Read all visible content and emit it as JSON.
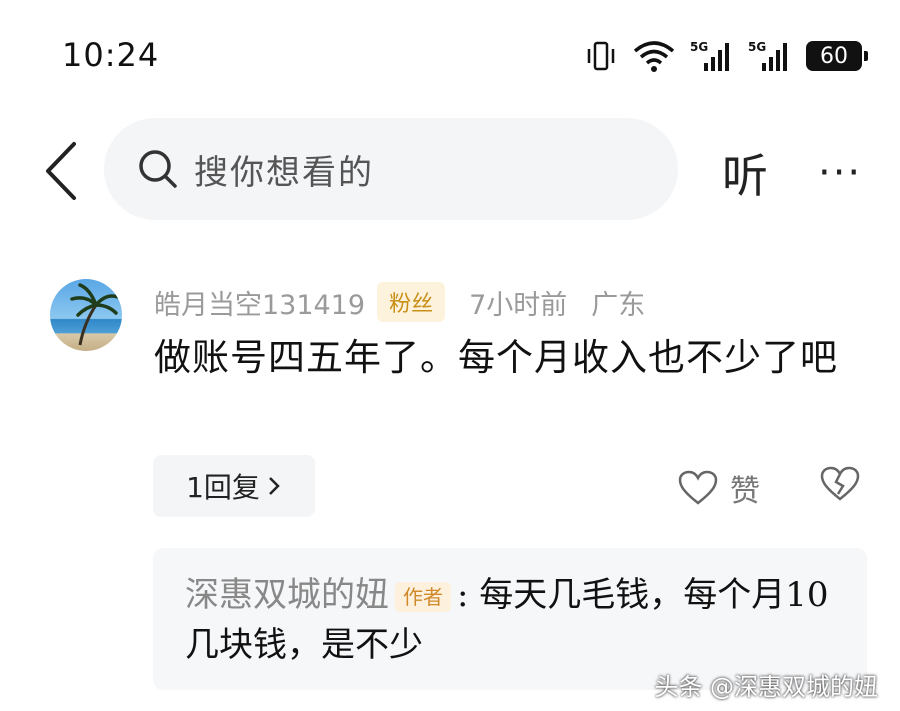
{
  "status_bar": {
    "time": "10:24",
    "battery": "60",
    "net1": "5G",
    "net2": "5G",
    "icons": [
      "vibrate-icon",
      "wifi-icon",
      "signal-5g-icon",
      "signal-5g-icon",
      "battery-icon"
    ]
  },
  "header": {
    "search_placeholder": "搜你想看的",
    "listen_label": "听",
    "more_label": "···"
  },
  "comment": {
    "username": "皓月当空131419",
    "fan_badge": "粉丝",
    "time_ago": "7小时前",
    "location": "广东",
    "text": "做账号四五年了。每个月收入也不少了吧",
    "reply_count_label": "1回复",
    "like_label": "赞"
  },
  "author_reply": {
    "author": "深惠双城的妞",
    "author_badge": "作者",
    "text": ": 每天几毛钱，每个月10几块钱，是不少"
  },
  "watermark": "头条 @深惠双城的妞",
  "colors": {
    "badge_bg": "#fdf3dc",
    "badge_text": "#c98f17",
    "panel_bg": "#f4f5f7"
  }
}
